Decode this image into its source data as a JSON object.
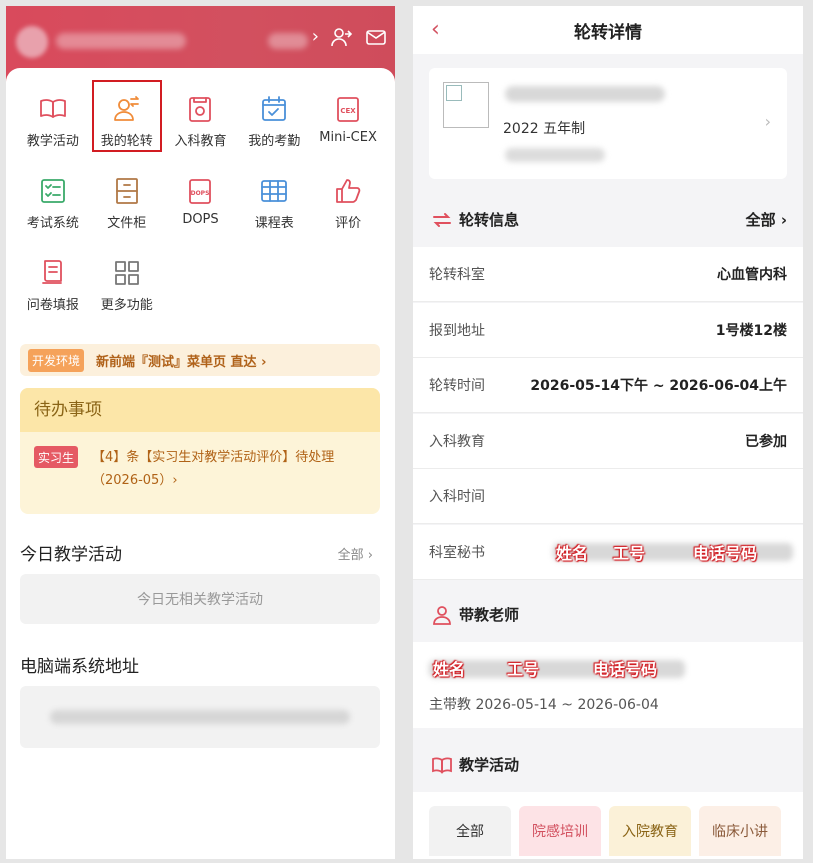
{
  "left": {
    "grid": [
      {
        "label": "教学活动",
        "icon": "book-icon",
        "color": "#e0505e"
      },
      {
        "label": "我的轮转",
        "icon": "user-rotate-icon",
        "color": "#f08c3a"
      },
      {
        "label": "入科教育",
        "icon": "badge-book-icon",
        "color": "#e0505e"
      },
      {
        "label": "我的考勤",
        "icon": "calendar-check-icon",
        "color": "#4a90d9"
      },
      {
        "label": "Mini-CEX",
        "icon": "cex-icon",
        "color": "#e0505e"
      },
      {
        "label": "考试系统",
        "icon": "exam-icon",
        "color": "#3aaa6a"
      },
      {
        "label": "文件柜",
        "icon": "cabinet-icon",
        "color": "#b07846"
      },
      {
        "label": "DOPS",
        "icon": "dops-icon",
        "color": "#e0505e"
      },
      {
        "label": "课程表",
        "icon": "table-icon",
        "color": "#4a90d9"
      },
      {
        "label": "评价",
        "icon": "thumbs-up-icon",
        "color": "#e0505e"
      },
      {
        "label": "问卷填报",
        "icon": "form-icon",
        "color": "#e0505e"
      },
      {
        "label": "更多功能",
        "icon": "more-grid-icon",
        "color": "#777777"
      }
    ],
    "dev": {
      "badge": "开发环境",
      "text": "新前端『测试』菜单页 直达 ›"
    },
    "todo": {
      "title": "待办事项",
      "badge": "实习生",
      "text": "【4】条【实习生对教学活动评价】待处理（2026-05）›"
    },
    "today": {
      "title": "今日教学活动",
      "more": "全部 ›",
      "empty": "今日无相关教学活动"
    },
    "pc": {
      "title": "电脑端系统地址"
    }
  },
  "right": {
    "title": "轮转详情",
    "back": "‹",
    "profile": {
      "year": "2022   五年制"
    },
    "rotation": {
      "title": "轮转信息",
      "all": "全部 ›"
    },
    "rows": [
      {
        "k": "轮转科室",
        "v": "心血管内科"
      },
      {
        "k": "报到地址",
        "v": "1号楼12楼"
      },
      {
        "k": "轮转时间",
        "v": "2026-05-14下午 ~ 2026-06-04上午"
      },
      {
        "k": "入科教育",
        "v": "已参加"
      },
      {
        "k": "入科时间",
        "v": ""
      },
      {
        "k": "科室秘书",
        "v": ""
      }
    ],
    "secretary": {
      "name": "姓名",
      "id": "工号",
      "phone": "电话号码"
    },
    "teacher": {
      "title": "带教老师",
      "name": "姓名",
      "id": "工号",
      "phone": "电话号码",
      "line": "主带教    2026-05-14 ~ 2026-06-04"
    },
    "activity": {
      "title": "教学活动"
    },
    "tabs": [
      {
        "label": "全部",
        "bg": "#f2f2f2",
        "fg": "#333333"
      },
      {
        "label": "院感培训",
        "bg": "#fde3e6",
        "fg": "#d2505f"
      },
      {
        "label": "入院教育",
        "bg": "#fbf1d8",
        "fg": "#8a6416"
      },
      {
        "label": "临床小讲",
        "bg": "#fcefe6",
        "fg": "#8a5a3a"
      }
    ]
  }
}
